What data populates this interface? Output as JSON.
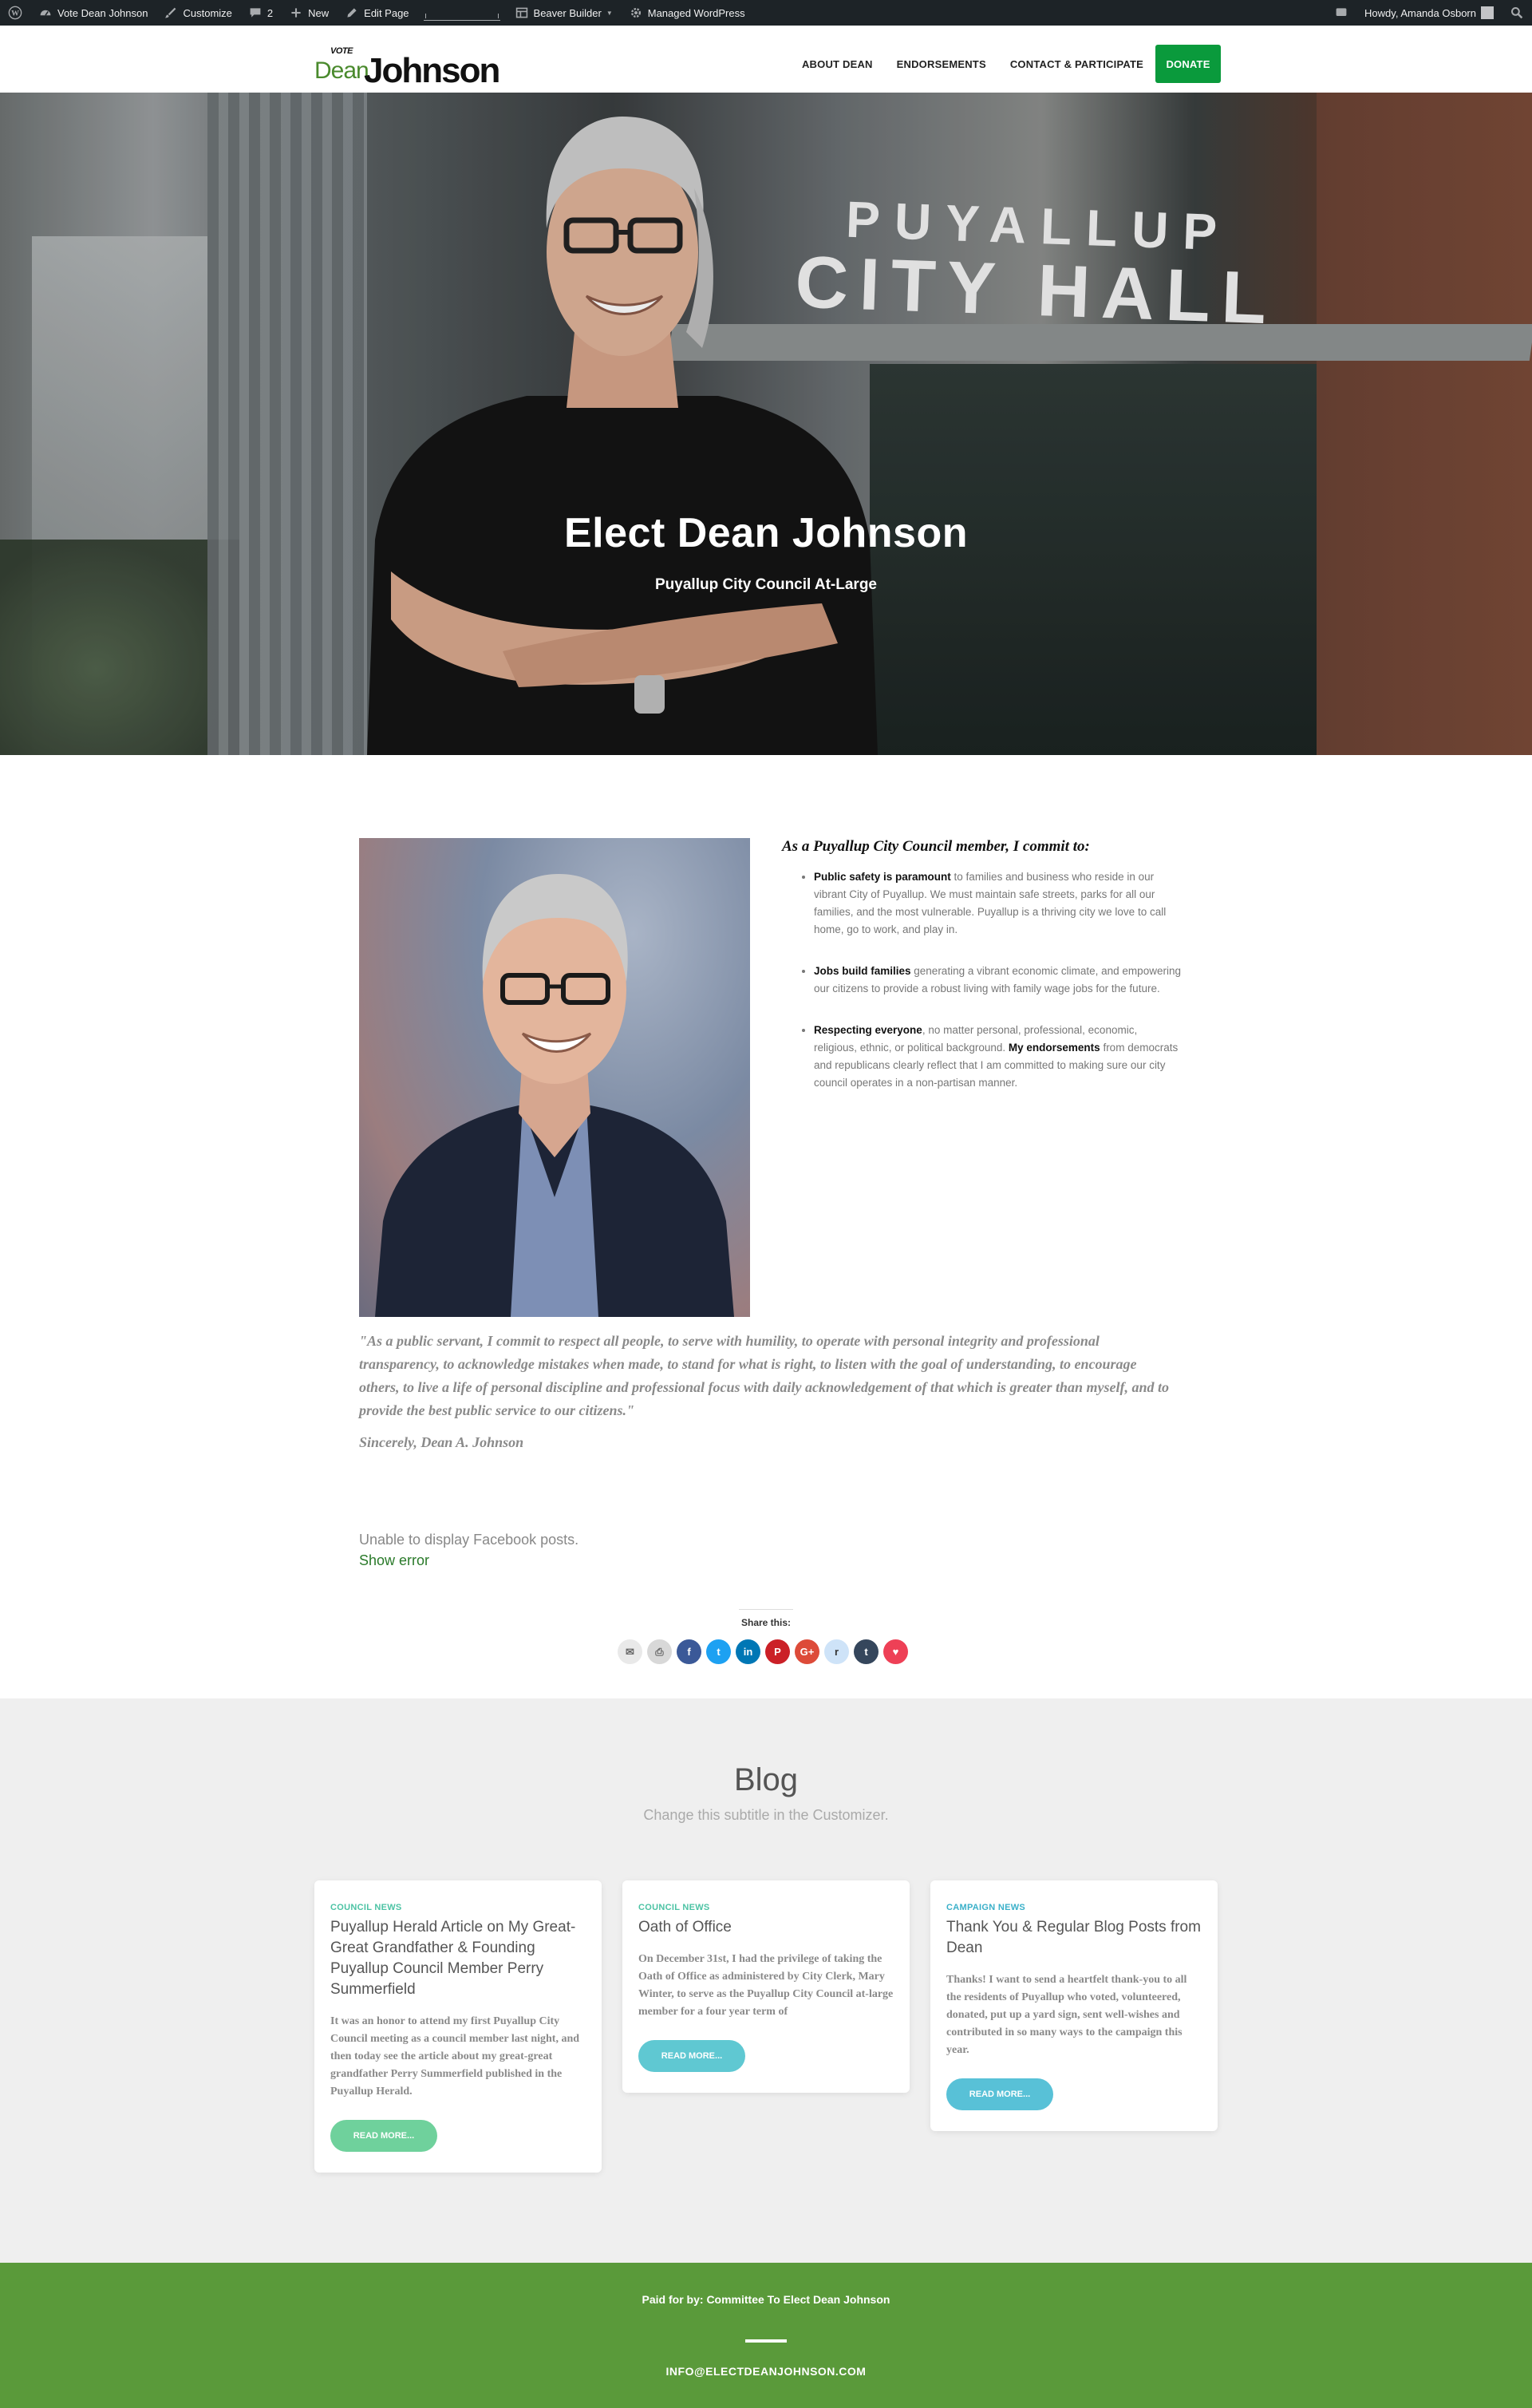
{
  "admin_bar": {
    "site_name": "Vote Dean Johnson",
    "customize": "Customize",
    "comments_count": "2",
    "new": "New",
    "edit_page": "Edit Page",
    "beaver_builder": "Beaver Builder",
    "managed_wp": "Managed WordPress",
    "howdy": "Howdy, Amanda Osborn"
  },
  "header": {
    "logo": {
      "vote": "VOTE",
      "first": "Dean",
      "last": "Johnson"
    },
    "nav": [
      {
        "label": "ABOUT DEAN"
      },
      {
        "label": "ENDORSEMENTS"
      },
      {
        "label": "CONTACT & PARTICIPATE"
      }
    ],
    "donate_label": "DONATE"
  },
  "hero": {
    "title": "Elect Dean Johnson",
    "subtitle": "Puyallup City Council At-Large",
    "sign_line1": "PUYALLUP",
    "sign_line2": "CITY HALL"
  },
  "commitments": {
    "heading": "As a Puyallup City Council member, I commit to:",
    "items": [
      {
        "bold": "Public safety is paramount",
        "text": " to families and business who reside in our vibrant City of Puyallup. We must maintain safe streets, parks for all our families, and the most vulnerable. Puyallup is a thriving city we love to call home, go to work, and play in."
      },
      {
        "bold": "Jobs build families",
        "text": " generating a vibrant economic climate, and empowering our citizens to provide a robust living with family wage jobs for the future."
      },
      {
        "bold": "Respecting everyone",
        "text": ", no matter personal, professional, economic, religious, ethnic, or political background. ",
        "bold2": "My endorsements",
        "text2": " from democrats and republicans clearly reflect that I am committed to making sure our city council operates in a non-partisan manner."
      }
    ]
  },
  "quote": {
    "text": "\"As a public servant, I commit to respect all people, to serve with humility, to operate with personal integrity and professional transparency, to acknowledge mistakes when made, to stand for what is right, to listen with the goal of understanding, to encourage others, to live a life of personal discipline and professional focus with daily acknowledgement of that which is greater than myself, and to provide the best public service to our citizens.\"",
    "signoff": "Sincerely, Dean A. Johnson"
  },
  "facebook": {
    "error": "Unable to display Facebook posts.",
    "show_error": "Show error"
  },
  "share": {
    "label": "Share this:",
    "buttons": [
      {
        "icon": "email-icon",
        "glyph": "✉",
        "color": "#e9e9e9",
        "fg": "#666"
      },
      {
        "icon": "print-icon",
        "glyph": "⎙",
        "color": "#d8d8d8",
        "fg": "#666"
      },
      {
        "icon": "facebook-icon",
        "glyph": "f",
        "color": "#3b5998",
        "fg": "#fff"
      },
      {
        "icon": "twitter-icon",
        "glyph": "t",
        "color": "#1da1f2",
        "fg": "#fff"
      },
      {
        "icon": "linkedin-icon",
        "glyph": "in",
        "color": "#0077b5",
        "fg": "#fff"
      },
      {
        "icon": "pinterest-icon",
        "glyph": "P",
        "color": "#cb2027",
        "fg": "#fff"
      },
      {
        "icon": "google-plus-icon",
        "glyph": "G+",
        "color": "#dd4b39",
        "fg": "#fff"
      },
      {
        "icon": "reddit-icon",
        "glyph": "r",
        "color": "#cee3f8",
        "fg": "#333"
      },
      {
        "icon": "tumblr-icon",
        "glyph": "t",
        "color": "#35465c",
        "fg": "#fff"
      },
      {
        "icon": "pocket-icon",
        "glyph": "♥",
        "color": "#ee4056",
        "fg": "#fff"
      }
    ]
  },
  "blog": {
    "title": "Blog",
    "subtitle": "Change this subtitle in the Customizer.",
    "posts": [
      {
        "category": "COUNCIL NEWS",
        "title": "Puyallup Herald Article on My Great-Great Grandfather & Founding Puyallup Council Member Perry Summerfield",
        "excerpt": "It was an honor to attend my first Puyallup City Council meeting as a council member last night, and then today see the article about my great-great grandfather Perry Summerfield published in the Puyallup Herald.",
        "button": "READ MORE..."
      },
      {
        "category": "COUNCIL NEWS",
        "title": "Oath of Office",
        "excerpt": "On December 31st, I had the privilege of taking the Oath of Office as administered by City Clerk, Mary Winter, to serve as the Puyallup City Council at-large member for a four year term of",
        "button": "READ MORE..."
      },
      {
        "category": "CAMPAIGN NEWS",
        "title": "Thank You & Regular Blog Posts from Dean",
        "excerpt": "Thanks! I want to send a heartfelt thank-you to all the residents of Puyallup who voted, volunteered, donated, put up a yard sign, sent well-wishes and contributed in so many ways to the campaign this year.",
        "button": "READ MORE..."
      }
    ]
  },
  "footer": {
    "paid_by": "Paid for by: Committee To Elect Dean Johnson",
    "email": "INFO@ELECTDEANJOHNSON.COM"
  },
  "colors": {
    "admin_bar": "#1d2327",
    "donate": "#0a9a3c",
    "footer": "#5a9a3a",
    "blog_bg": "#efefef"
  }
}
